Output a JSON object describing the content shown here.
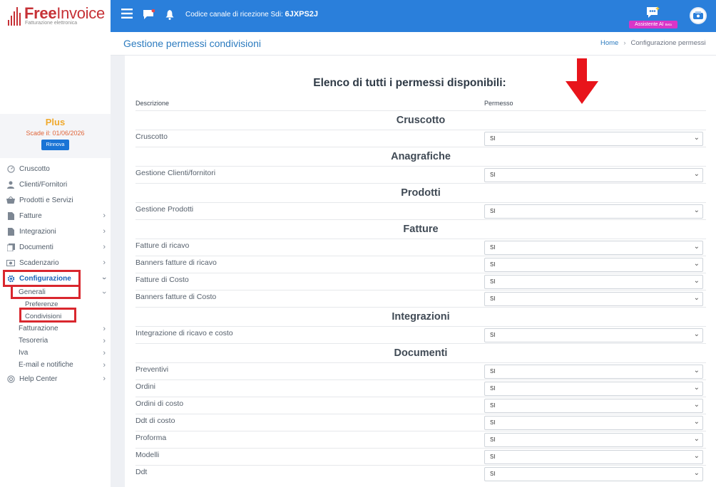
{
  "brand": {
    "name_part1": "Free",
    "name_part2": "Invoice",
    "tagline": "Fatturazione elettronica",
    "color": "#c63136"
  },
  "plan": {
    "name": "Plus",
    "expiry": "Scade il: 01/06/2026",
    "renew_label": "Rinnova"
  },
  "sidebar": {
    "items": [
      {
        "label": "Cruscotto",
        "icon": "dashboard-icon"
      },
      {
        "label": "Clienti/Fornitori",
        "icon": "user-icon"
      },
      {
        "label": "Prodotti e Servizi",
        "icon": "basket-icon"
      },
      {
        "label": "Fatture",
        "icon": "document-icon"
      },
      {
        "label": "Integrazioni",
        "icon": "document-icon"
      },
      {
        "label": "Documenti",
        "icon": "documents-icon"
      },
      {
        "label": "Scadenzario",
        "icon": "money-icon"
      },
      {
        "label": "Configurazione",
        "icon": "gear-icon"
      }
    ],
    "config_sub": {
      "generali": "Generali",
      "preferenze": "Preferenze",
      "condivisioni": "Condivisioni",
      "fatturazione": "Fatturazione",
      "tesoreria": "Tesoreria",
      "iva": "Iva",
      "email": "E-mail e notifiche"
    },
    "help": "Help Center"
  },
  "topbar": {
    "channel_label": "Codice canale di ricezione Sdi:",
    "channel_code": "6JXPS2J",
    "ai_label": "Assistente AI",
    "ai_badge": "Beta",
    "accent": "#2a7fdb"
  },
  "header": {
    "title": "Gestione permessi condivisioni",
    "breadcrumb_home": "Home",
    "breadcrumb_current": "Configurazione permessi"
  },
  "content": {
    "title": "Elenco di tutti i permessi disponibili:",
    "col_description": "Descrizione",
    "col_permission": "Permesso",
    "sections": [
      {
        "name": "Cruscotto",
        "rows": [
          {
            "label": "Cruscotto",
            "value": "SI"
          }
        ]
      },
      {
        "name": "Anagrafiche",
        "rows": [
          {
            "label": "Gestione Clienti/fornitori",
            "value": "SI"
          }
        ]
      },
      {
        "name": "Prodotti",
        "rows": [
          {
            "label": "Gestione Prodotti",
            "value": "SI"
          }
        ]
      },
      {
        "name": "Fatture",
        "rows": [
          {
            "label": "Fatture di ricavo",
            "value": "SI"
          },
          {
            "label": "Banners fatture di ricavo",
            "value": "SI"
          },
          {
            "label": "Fatture di Costo",
            "value": "SI"
          },
          {
            "label": "Banners fatture di Costo",
            "value": "SI"
          }
        ]
      },
      {
        "name": "Integrazioni",
        "rows": [
          {
            "label": "Integrazione di ricavo e costo",
            "value": "SI"
          }
        ]
      },
      {
        "name": "Documenti",
        "rows": [
          {
            "label": "Preventivi",
            "value": "SI"
          },
          {
            "label": "Ordini",
            "value": "SI"
          },
          {
            "label": "Ordini di costo",
            "value": "SI"
          },
          {
            "label": "Ddt di costo",
            "value": "SI"
          },
          {
            "label": "Proforma",
            "value": "SI"
          },
          {
            "label": "Modelli",
            "value": "SI"
          },
          {
            "label": "Ddt",
            "value": "SI"
          }
        ]
      }
    ]
  },
  "annotation_color": "#d9272e"
}
